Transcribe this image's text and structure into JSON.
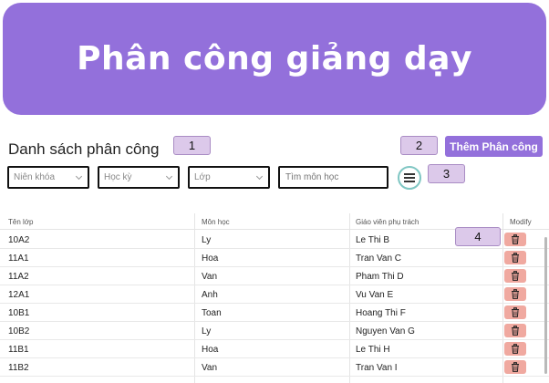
{
  "banner": {
    "title": "Phân công giảng dạy"
  },
  "section": {
    "title": "Danh sách phân công"
  },
  "markers": [
    "1",
    "2",
    "3",
    "4"
  ],
  "toolbar": {
    "add_label": "Thêm Phân công"
  },
  "filters": {
    "year_placeholder": "Niên khóa",
    "semester_placeholder": "Học kỳ",
    "class_placeholder": "Lớp",
    "search_placeholder": "Tìm môn học"
  },
  "table": {
    "headers": [
      "Tên lớp",
      "Môn học",
      "Giáo viên phụ trách",
      "Modify"
    ],
    "rows": [
      [
        "10A2",
        "Ly",
        "Le Thi B"
      ],
      [
        "11A1",
        "Hoa",
        "Tran Van C"
      ],
      [
        "11A2",
        "Van",
        "Pham Thi D"
      ],
      [
        "12A1",
        "Anh",
        "Vu Van E"
      ],
      [
        "10B1",
        "Toan",
        "Hoang Thi F"
      ],
      [
        "10B2",
        "Ly",
        "Nguyen Van G"
      ],
      [
        "11B1",
        "Hoa",
        "Le Thi H"
      ],
      [
        "11B2",
        "Van",
        "Tran Van I"
      ]
    ]
  },
  "icons": {
    "delete": "trash-icon",
    "menu": "hamburger-menu-icon"
  },
  "colors": {
    "accent": "#9370db",
    "marker_bg": "#dcc9ea",
    "delete_bg": "#f0a9a0",
    "menu_ring": "#7fc6c3"
  }
}
